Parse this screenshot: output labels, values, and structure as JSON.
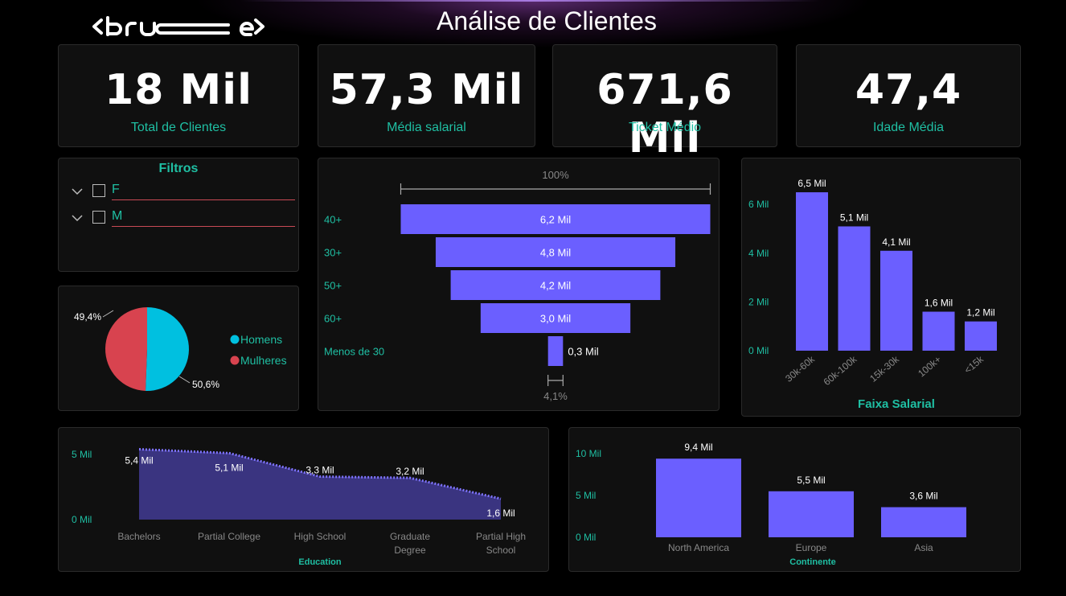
{
  "header": {
    "title": "Análise de Clientes",
    "logo_text": "<bru e>"
  },
  "kpis": [
    {
      "value": "18 Mil",
      "label": "Total de Clientes"
    },
    {
      "value": "57,3 Mil",
      "label": "Média salarial"
    },
    {
      "value": "671,6 Mil",
      "label": "Ticket Médio"
    },
    {
      "value": "47,4",
      "label": "Idade Média"
    }
  ],
  "filters": {
    "title": "Filtros",
    "items": [
      {
        "label": "F"
      },
      {
        "label": "M"
      }
    ]
  },
  "colors": {
    "accent": "#1fbfa3",
    "bar": "#6b5fff",
    "pie_men": "#00c0e0",
    "pie_women": "#d8434f",
    "area": "#3a3480"
  },
  "chart_data": [
    {
      "type": "pie",
      "id": "gender",
      "labels": [
        "Homens",
        "Mulheres"
      ],
      "values": [
        50.6,
        49.4
      ],
      "data_labels": [
        "50,6%",
        "49,4%"
      ],
      "legend": "right"
    },
    {
      "type": "bar",
      "id": "age_funnel",
      "orientation": "funnel",
      "categories": [
        "40+",
        "30+",
        "50+",
        "60+",
        "Menos de 30"
      ],
      "values": [
        6.2,
        4.8,
        4.2,
        3.0,
        0.3
      ],
      "data_labels": [
        "6,2 Mil",
        "4,8 Mil",
        "4,2 Mil",
        "3,0 Mil",
        "0,3 Mil"
      ],
      "top_label": "100%",
      "bottom_label": "4,1%"
    },
    {
      "type": "bar",
      "id": "salary",
      "title": "Faixa Salarial",
      "categories": [
        "30k-60k",
        "60k-100k",
        "15k-30k",
        "100k+",
        "<15k"
      ],
      "values": [
        6.5,
        5.1,
        4.1,
        1.6,
        1.2
      ],
      "data_labels": [
        "6,5 Mil",
        "5,1 Mil",
        "4,1 Mil",
        "1,6 Mil",
        "1,2 Mil"
      ],
      "yticks": [
        "0 Mil",
        "2 Mil",
        "4 Mil",
        "6 Mil"
      ],
      "ylim": [
        0,
        7
      ]
    },
    {
      "type": "area",
      "id": "education",
      "xlabel": "Education",
      "categories": [
        "Bachelors",
        "Partial College",
        "High School",
        "Graduate Degree",
        "Partial High School"
      ],
      "values": [
        5.4,
        5.1,
        3.3,
        3.2,
        1.6
      ],
      "data_labels": [
        "5,4 Mil",
        "5,1 Mil",
        "3,3 Mil",
        "3,2 Mil",
        "1,6 Mil"
      ],
      "yticks": [
        "0 Mil",
        "5 Mil"
      ],
      "ylim": [
        0,
        5
      ]
    },
    {
      "type": "bar",
      "id": "continent",
      "xlabel": "Continente",
      "categories": [
        "North America",
        "Europe",
        "Asia"
      ],
      "values": [
        9.4,
        5.5,
        3.6
      ],
      "data_labels": [
        "9,4 Mil",
        "5,5 Mil",
        "3,6 Mil"
      ],
      "yticks": [
        "0 Mil",
        "5 Mil",
        "10 Mil"
      ],
      "ylim": [
        0,
        10
      ]
    }
  ]
}
